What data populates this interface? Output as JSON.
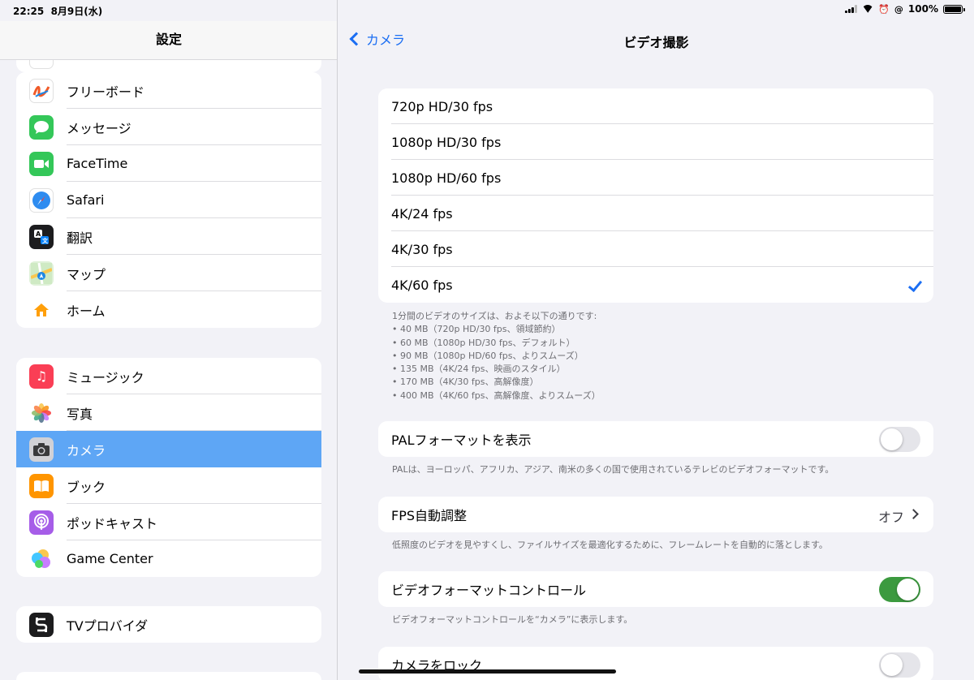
{
  "status": {
    "time": "22:25",
    "date": "8月9日(水)",
    "battery": "100%"
  },
  "sidebar": {
    "title": "設定",
    "group1": [
      {
        "label": "フリーボード",
        "icon": "freeform-icon",
        "color": "#ffffff"
      },
      {
        "label": "メッセージ",
        "icon": "messages-icon",
        "color": "#34c759"
      },
      {
        "label": "FaceTime",
        "icon": "facetime-icon",
        "color": "#34c759"
      },
      {
        "label": "Safari",
        "icon": "safari-icon",
        "color": "#1e88e5"
      },
      {
        "label": "翻訳",
        "icon": "translate-icon",
        "color": "#1c1c1e"
      },
      {
        "label": "マップ",
        "icon": "maps-icon",
        "color": "#6fcf6f"
      },
      {
        "label": "ホーム",
        "icon": "home-icon",
        "color": "#ffffff"
      }
    ],
    "group2": [
      {
        "label": "ミュージック",
        "icon": "music-icon",
        "color": "#fa3e55"
      },
      {
        "label": "写真",
        "icon": "photos-icon",
        "color": "#ffffff"
      },
      {
        "label": "カメラ",
        "icon": "camera-icon",
        "color": "#8e8e93"
      },
      {
        "label": "ブック",
        "icon": "books-icon",
        "color": "#ff9500"
      },
      {
        "label": "ポッドキャスト",
        "icon": "podcasts-icon",
        "color": "#a65de8"
      },
      {
        "label": "Game Center",
        "icon": "game-center-icon",
        "color": "#ffffff"
      }
    ],
    "group3": [
      {
        "label": "TVプロバイダ",
        "icon": "tv-provider-icon",
        "color": "#1c1c1e"
      }
    ]
  },
  "nav": {
    "back_label": "カメラ",
    "title": "ビデオ撮影"
  },
  "formats": {
    "options": [
      "720p HD/30 fps",
      "1080p HD/30 fps",
      "1080p HD/60 fps",
      "4K/24 fps",
      "4K/30 fps",
      "4K/60 fps"
    ],
    "selected_index": 5,
    "footer_lines": [
      "1分間のビデオのサイズは、およそ以下の通りです:",
      "• 40 MB（720p HD/30 fps、領域節約）",
      "• 60 MB（1080p HD/30 fps、デフォルト）",
      "• 90 MB（1080p HD/60 fps、よりスムーズ）",
      "• 135 MB（4K/24 fps、映画のスタイル）",
      "• 170 MB（4K/30 fps、高解像度）",
      "• 400 MB（4K/60 fps、高解像度、よりスムーズ）"
    ]
  },
  "pal": {
    "label": "PALフォーマットを表示",
    "on": false,
    "footer": "PALは、ヨーロッパ、アフリカ、アジア、南米の多くの国で使用されているテレビのビデオフォーマットです。"
  },
  "fps_auto": {
    "label": "FPS自動調整",
    "value": "オフ",
    "footer": "低照度のビデオを見やすくし、ファイルサイズを最適化するために、フレームレートを自動的に落とします。"
  },
  "video_format_control": {
    "label": "ビデオフォーマットコントロール",
    "on": true,
    "footer": "ビデオフォーマットコントロールを“カメラ”に表示します。"
  },
  "lock_camera": {
    "label": "カメラをロック",
    "on": false
  }
}
